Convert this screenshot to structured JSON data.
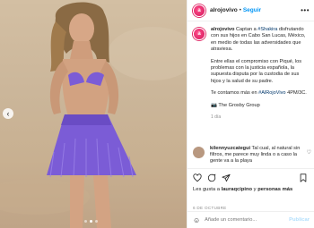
{
  "post": {
    "username": "alrojovivo",
    "follow_label": "Seguir",
    "separator": "•",
    "more_label": "•••",
    "caption": {
      "username": "alrojovivo",
      "line1_pre": "Captan a ",
      "line1_tag": "#Shakira",
      "line1_post": " disfrutando con sus hijos en Cabo San Lucas, México, en medio de todas las adversidades que atraviesa.",
      "paragraph2": "Entre ellas el compromiso con Piqué, los problemas con la justicia española, la supuesta disputa por la custodia de sus hijos y la salud de su padre.",
      "paragraph3_pre": "Te contamos más en ",
      "paragraph3_tag": "#AlRojoVivo",
      "paragraph3_post": " 4PM/3C.",
      "credit": "📷 The Grosby Group"
    },
    "time_ago": "1 día",
    "comment": {
      "username": "kilennyuzcategui",
      "text": "Tal cual, al natural sin filtros, me parece muy linda o a caso la gente va a la playa"
    },
    "likes": {
      "prefix": "Les gusta a ",
      "user": "lauraqcipino",
      "middle": " y ",
      "others": "personas más"
    },
    "date": "6 DE OCTUBRE",
    "comment_placeholder": "Añade un comentario...",
    "publish_label": "Publicar"
  },
  "icons": {
    "nav_prev": "chevron-left-icon",
    "like": "heart-icon",
    "comment": "speech-bubble-icon",
    "share": "paper-plane-icon",
    "save": "bookmark-icon",
    "emoji": "smiley-icon"
  },
  "colors": {
    "accent": "#0095f6",
    "brand": "#e1306c",
    "skirt": "#7b5cd6"
  },
  "carousel": {
    "count": 3,
    "active": 1
  }
}
